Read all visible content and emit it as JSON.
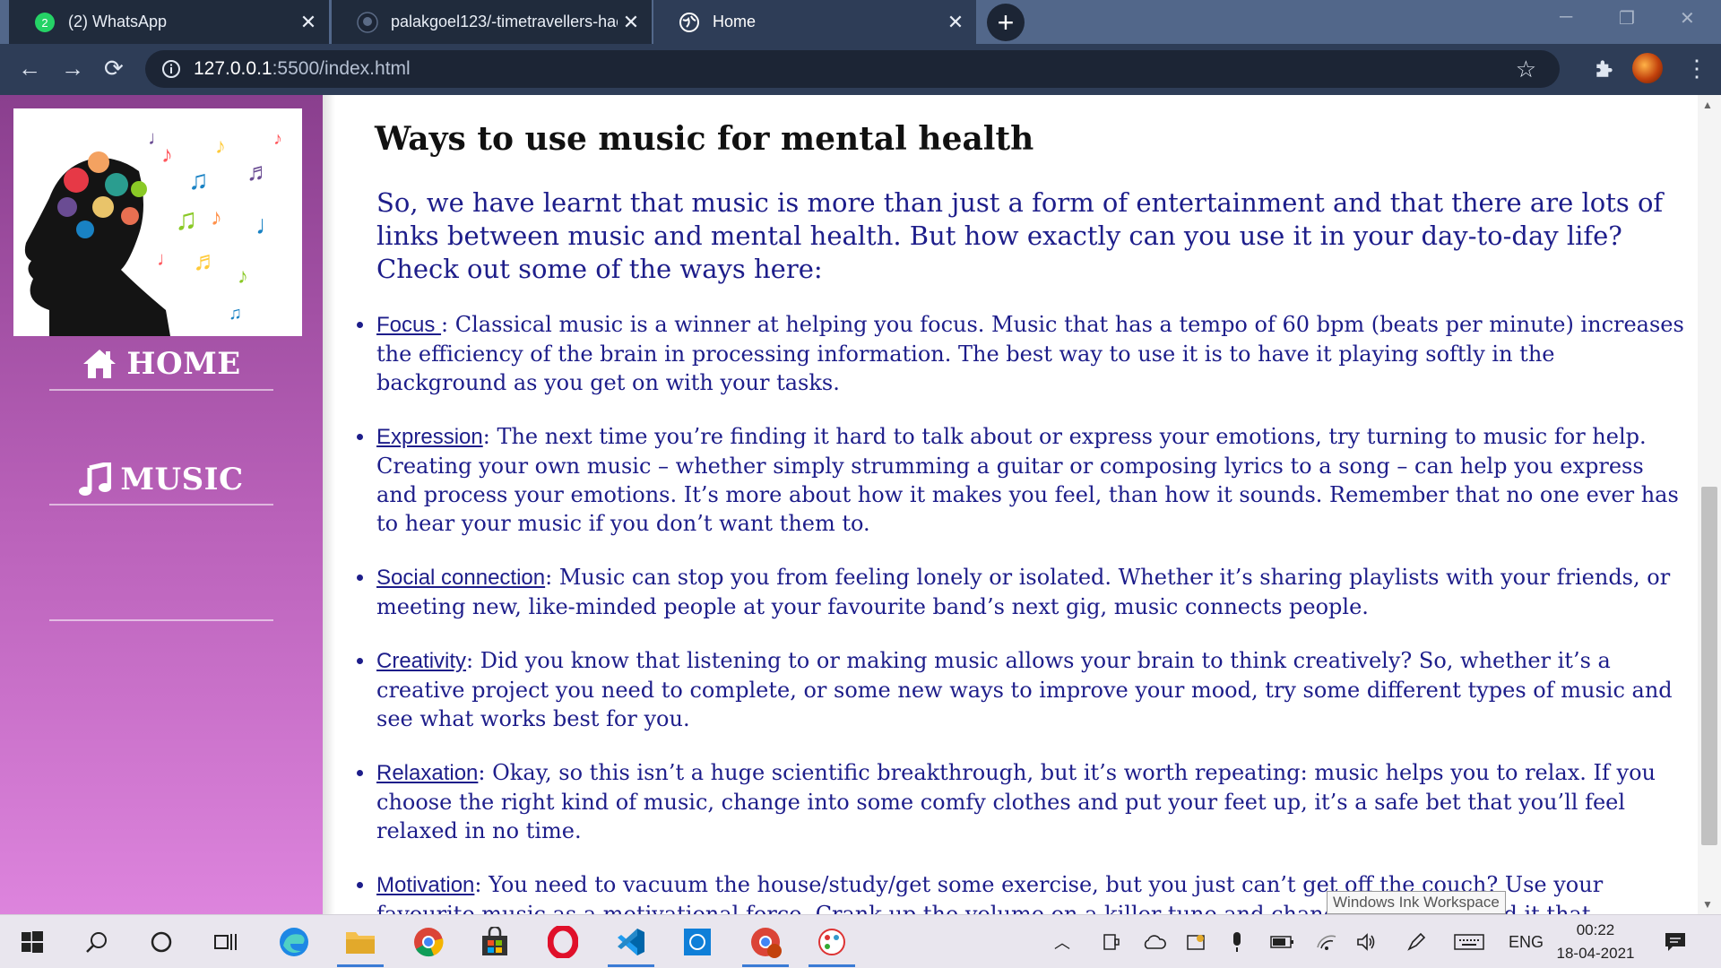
{
  "browser": {
    "tabs": [
      {
        "title": "(2) WhatsApp",
        "active": false,
        "icon": "whatsapp-icon"
      },
      {
        "title": "palakgoel123/-timetravellers-hac",
        "active": false,
        "icon": "github-icon"
      },
      {
        "title": "Home",
        "active": true,
        "icon": "globe-icon"
      }
    ],
    "url_host": "127.0.0.1",
    "url_rest": ":5500/index.html"
  },
  "sidebar": {
    "nav": [
      {
        "label": "HOME",
        "icon": "home-icon"
      },
      {
        "label": "MUSIC",
        "icon": "music-note-icon"
      }
    ]
  },
  "content": {
    "heading": "Ways to use music for mental health",
    "intro": "So, we have learnt that music is more than just a form of entertainment and that there are lots of links between music and mental health. But how exactly can you use it in your day-to-day life? Check out some of the ways here:",
    "tips": [
      {
        "term": "Focus ",
        "text": ": Classical music is a winner at helping you focus. Music that has a tempo of 60 bpm (beats per minute) increases the efficiency of the brain in processing information. The best way to use it is to have it playing softly in the background as you get on with your tasks."
      },
      {
        "term": "Expression",
        "text": ": The next time you’re finding it hard to talk about or express your emotions, try turning to music for help. Creating your own music – whether simply strumming a guitar or composing lyrics to a song – can help you express and process your emotions. It’s more about how it makes you feel, than how it sounds. Remember that no one ever has to hear your music if you don’t want them to."
      },
      {
        "term": "Social connection",
        "text": ": Music can stop you from feeling lonely or isolated. Whether it’s sharing playlists with your friends, or meeting new, like-minded people at your favourite band’s next gig, music connects people."
      },
      {
        "term": "Creativity",
        "text": ": Did you know that listening to or making music allows your brain to think creatively? So, whether it’s a creative project you need to complete, or some new ways to improve your mood, try some different types of music and see what works best for you."
      },
      {
        "term": "Relaxation",
        "text": ": Okay, so this isn’t a huge scientific breakthrough, but it’s worth repeating: music helps you to relax. If you choose the right kind of music, change into some comfy clothes and put your feet up, it’s a safe bet that you’ll feel relaxed in no time."
      },
      {
        "term": "Motivation",
        "text": ": You need to vacuum the house/study/get some exercise, but you just can’t get off the couch? Use your favourite music as a motivational force. Crank up the volume on a killer tune and chances are you’ll find it that"
      }
    ]
  },
  "tooltip": "Windows Ink Workspace",
  "taskbar": {
    "language": "ENG",
    "time": "00:22",
    "date": "18-04-2021"
  },
  "colors": {
    "sidebar_top": "#8a3f8e",
    "sidebar_bottom": "#dd84dd",
    "text_blue": "#1d1d8a",
    "browser_frame": "#2e3d57"
  }
}
